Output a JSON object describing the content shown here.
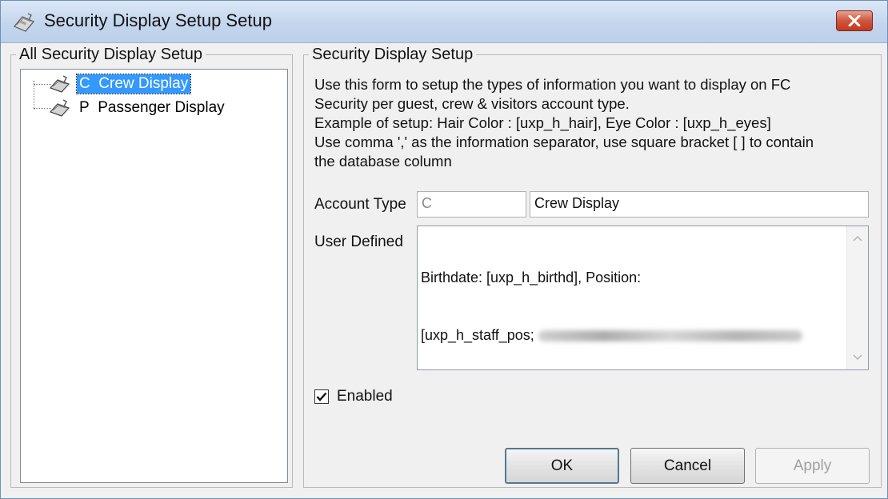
{
  "window": {
    "title": "Security Display Setup Setup",
    "icon": "app-icon",
    "close_icon": "close-icon"
  },
  "left_panel": {
    "group_title": "All Security Display Setup",
    "tree": [
      {
        "code": "C",
        "label": "Crew Display",
        "selected": true,
        "icon": "display-icon"
      },
      {
        "code": "P",
        "label": "Passenger Display",
        "selected": false,
        "icon": "display-icon"
      }
    ]
  },
  "right_panel": {
    "group_title": "Security Display Setup",
    "description": [
      "Use this form to setup the types of information you want to display on FC",
      "Security per guest, crew & visitors account type.",
      "Example of setup: Hair Color : [uxp_h_hair], Eye Color : [uxp_h_eyes]",
      "Use comma ',' as the information separator, use square bracket [ ] to contain",
      "the database column"
    ],
    "account_type_label": "Account Type",
    "account_type_code": "C",
    "account_type_name": "Crew Display",
    "user_defined_label": "User Defined",
    "user_defined_line1": "Birthdate: [uxp_h_birthd], Position:",
    "user_defined_line2": "[uxp_h_staff_pos;",
    "enabled_label": "Enabled",
    "enabled_checked": true
  },
  "buttons": {
    "ok": "OK",
    "cancel": "Cancel",
    "apply": "Apply"
  }
}
